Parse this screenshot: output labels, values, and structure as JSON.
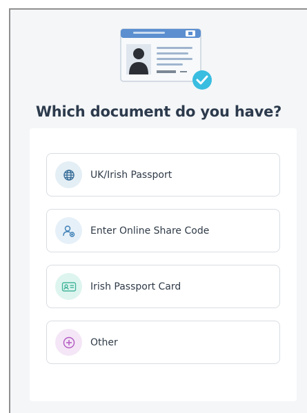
{
  "heading": "Which document do you have?",
  "options": [
    {
      "label": "UK/Irish Passport",
      "icon": "globe-icon",
      "bg": "#e4eef5",
      "stroke": "#3a6f99"
    },
    {
      "label": "Enter Online Share Code",
      "icon": "user-share-icon",
      "bg": "#e6f0f8",
      "stroke": "#3d7fb5"
    },
    {
      "label": "Irish Passport Card",
      "icon": "id-card-icon",
      "bg": "#def5ef",
      "stroke": "#43b49b"
    },
    {
      "label": "Other",
      "icon": "plus-circle-icon",
      "bg": "#f4e6f6",
      "stroke": "#b256c2"
    }
  ]
}
